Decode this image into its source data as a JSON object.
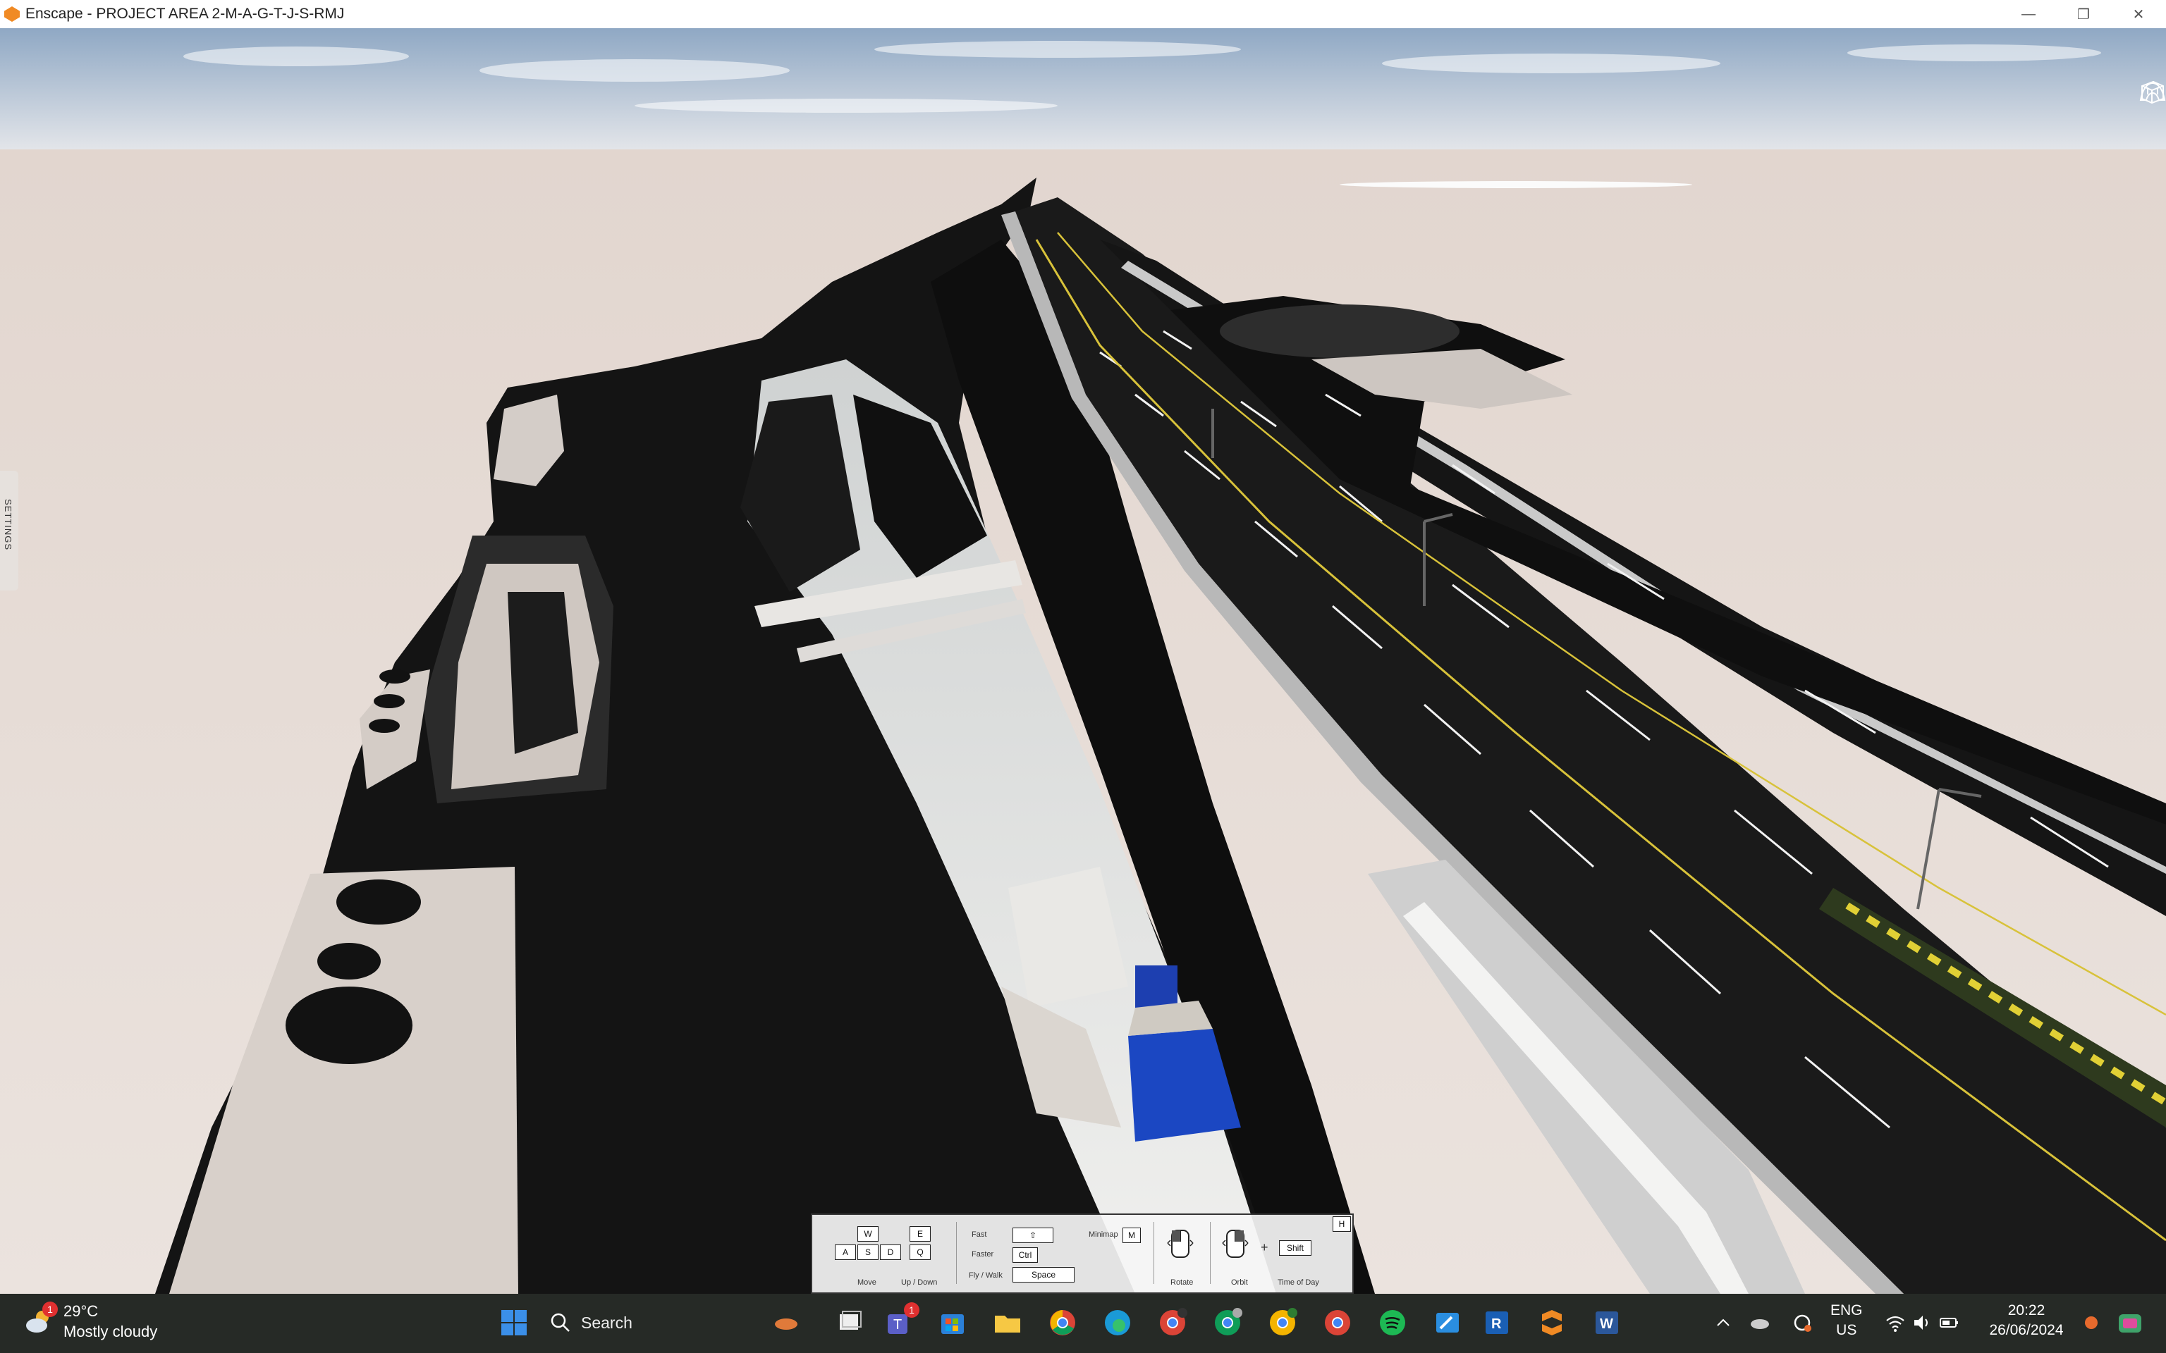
{
  "window": {
    "title": "Enscape - PROJECT AREA 2-M-A-G-T-J-S-RMJ",
    "minimize_glyph": "—",
    "restore_glyph": "❐",
    "close_glyph": "✕"
  },
  "sidebar": {
    "settings_label": "SETTINGS"
  },
  "controls": {
    "move_keys": [
      "W",
      "A",
      "S",
      "D"
    ],
    "updown_keys": [
      "E",
      "Q"
    ],
    "move_label": "Move",
    "updown_label": "Up / Down",
    "fast_label": "Fast",
    "faster_label": "Faster",
    "faster_key": "Ctrl",
    "flywalk_label": "Fly / Walk",
    "flywalk_key": "Space",
    "minimap_label": "Minimap",
    "minimap_key": "M",
    "rotate_label": "Rotate",
    "orbit_label": "Orbit",
    "timeofday_label": "Time of Day",
    "shift_key": "Shift",
    "plus": "+",
    "hide_key": "H"
  },
  "taskbar": {
    "weather_temp": "29°C",
    "weather_desc": "Mostly cloudy",
    "weather_badge": "1",
    "search_placeholder": "Search",
    "teams_badge": "1",
    "apps": [
      "start-icon",
      "search-icon",
      "task-view-icon",
      "teams-icon",
      "store-icon",
      "file-explorer-icon",
      "chrome-icon",
      "edge-icon",
      "chrome-profile-1-icon",
      "chrome-profile-2-icon",
      "chrome-profile-3-icon",
      "chrome-profile-4-icon",
      "spotify-icon",
      "paint-icon",
      "revit-icon",
      "enscape-icon",
      "word-icon"
    ],
    "language": "ENG",
    "region": "US",
    "time": "20:22",
    "date": "26/06/2024"
  },
  "colors": {
    "enscape_orange": "#f08a24",
    "sky": "#b9c8d8",
    "ground": "#e6dcd6",
    "asphalt": "#151515",
    "taskbar": "#2a2e2a"
  }
}
